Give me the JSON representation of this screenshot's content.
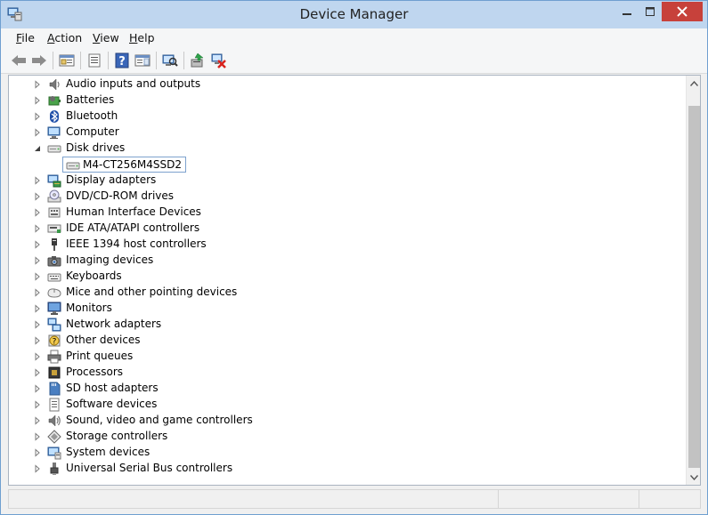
{
  "window": {
    "title": "Device Manager",
    "buttons": {
      "minimize": "minimize",
      "maximize": "maximize",
      "close": "close"
    },
    "close_color": "#c7413b"
  },
  "menu": [
    {
      "label": "File",
      "mnemonic": "F"
    },
    {
      "label": "Action",
      "mnemonic": "A"
    },
    {
      "label": "View",
      "mnemonic": "V"
    },
    {
      "label": "Help",
      "mnemonic": "H"
    }
  ],
  "toolbar": {
    "icons": [
      "back-arrow-icon",
      "forward-arrow-icon",
      "console-tree-icon",
      "properties-icon",
      "help-icon",
      "action-pane-icon",
      "scan-hardware-icon",
      "update-driver-icon",
      "uninstall-device-icon"
    ]
  },
  "tree": {
    "categories": [
      {
        "label": "Audio inputs and outputs",
        "icon": "speaker-icon",
        "expanded": false
      },
      {
        "label": "Batteries",
        "icon": "battery-icon",
        "expanded": false
      },
      {
        "label": "Bluetooth",
        "icon": "bluetooth-icon",
        "expanded": false
      },
      {
        "label": "Computer",
        "icon": "computer-icon",
        "expanded": false
      },
      {
        "label": "Disk drives",
        "icon": "disk-drive-icon",
        "expanded": true,
        "children": [
          {
            "label": "M4-CT256M4SSD2",
            "icon": "disk-drive-icon",
            "selected": true
          }
        ]
      },
      {
        "label": "Display adapters",
        "icon": "display-adapter-icon",
        "expanded": false
      },
      {
        "label": "DVD/CD-ROM drives",
        "icon": "dvd-drive-icon",
        "expanded": false
      },
      {
        "label": "Human Interface Devices",
        "icon": "hid-icon",
        "expanded": false
      },
      {
        "label": "IDE ATA/ATAPI controllers",
        "icon": "ide-controller-icon",
        "expanded": false
      },
      {
        "label": "IEEE 1394 host controllers",
        "icon": "ieee1394-icon",
        "expanded": false
      },
      {
        "label": "Imaging devices",
        "icon": "camera-icon",
        "expanded": false
      },
      {
        "label": "Keyboards",
        "icon": "keyboard-icon",
        "expanded": false
      },
      {
        "label": "Mice and other pointing devices",
        "icon": "mouse-icon",
        "expanded": false
      },
      {
        "label": "Monitors",
        "icon": "monitor-icon",
        "expanded": false
      },
      {
        "label": "Network adapters",
        "icon": "network-adapter-icon",
        "expanded": false
      },
      {
        "label": "Other devices",
        "icon": "unknown-device-icon",
        "expanded": false
      },
      {
        "label": "Print queues",
        "icon": "printer-icon",
        "expanded": false
      },
      {
        "label": "Processors",
        "icon": "processor-icon",
        "expanded": false
      },
      {
        "label": "SD host adapters",
        "icon": "sd-card-icon",
        "expanded": false
      },
      {
        "label": "Software devices",
        "icon": "software-device-icon",
        "expanded": false
      },
      {
        "label": "Sound, video and game controllers",
        "icon": "sound-controller-icon",
        "expanded": false
      },
      {
        "label": "Storage controllers",
        "icon": "storage-controller-icon",
        "expanded": false
      },
      {
        "label": "System devices",
        "icon": "system-device-icon",
        "expanded": false
      },
      {
        "label": "Universal Serial Bus controllers",
        "icon": "usb-icon",
        "expanded": false
      }
    ]
  },
  "colors": {
    "selection_border": "#7da2ce",
    "titlebar": "#bfd6ef",
    "close_button": "#c7413b"
  }
}
